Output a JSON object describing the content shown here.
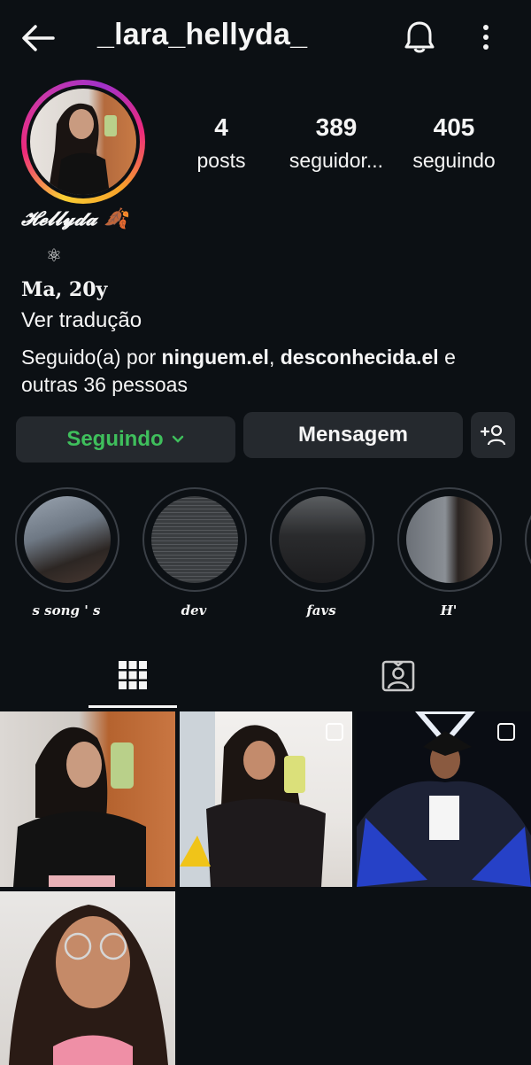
{
  "header": {
    "username": "_lara_hellyda_",
    "back_icon": "arrow-left-icon",
    "bell_icon": "bell-icon",
    "more_icon": "more-vertical-icon"
  },
  "profile": {
    "display_name": "𝓗𝓮𝓵𝓵𝔂𝓭𝓪 🍂",
    "atom_symbol": "⚛",
    "bio_line1": "Ma, 20y",
    "translate": "Ver tradução",
    "followed_prefix": "Seguido(a) por ",
    "followed_user1": "ninguem.el",
    "followed_sep": ", ",
    "followed_user2": "desconhecida.el",
    "followed_suffix": " e",
    "followed_others": "outras 36 pessoas"
  },
  "stats": [
    {
      "value": "4",
      "label": "posts"
    },
    {
      "value": "389",
      "label": "seguidor..."
    },
    {
      "value": "405",
      "label": "seguindo"
    }
  ],
  "actions": {
    "following_label": "Seguindo",
    "message_label": "Mensagem",
    "add_user_icon": "add-person-icon"
  },
  "highlights": [
    {
      "label": "s song ' s"
    },
    {
      "label": "dev"
    },
    {
      "label": "favs"
    },
    {
      "label": "H'"
    }
  ],
  "tabs": {
    "grid_icon": "grid-icon",
    "tagged_icon": "tagged-person-icon"
  },
  "colors": {
    "background": "#0c1014",
    "button": "#25292e",
    "following_green": "#3fbf5c"
  }
}
